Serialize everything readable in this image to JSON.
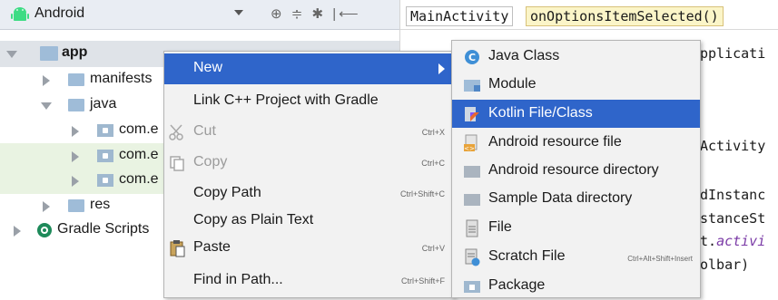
{
  "project_panel": {
    "view_title": "Android",
    "tree": [
      {
        "label": "app",
        "expanded": true,
        "type": "module"
      },
      {
        "label": "manifests",
        "expanded": false,
        "type": "folder"
      },
      {
        "label": "java",
        "expanded": true,
        "type": "folder"
      },
      {
        "label": "com.e",
        "expanded": false,
        "type": "package"
      },
      {
        "label": "com.e",
        "expanded": false,
        "type": "package"
      },
      {
        "label": "com.e",
        "expanded": false,
        "type": "package"
      },
      {
        "label": "res",
        "expanded": false,
        "type": "res-folder"
      },
      {
        "label": "Gradle Scripts",
        "expanded": false,
        "type": "gradle"
      }
    ]
  },
  "editor": {
    "breadcrumb": [
      "MainActivity",
      "onOptionsItemSelected()"
    ],
    "code_fragments": [
      "pplicati",
      "Activity",
      "dInstanc",
      "stanceSt",
      "t.",
      "activi",
      "olbar)"
    ]
  },
  "context_menu": {
    "items": [
      {
        "label": "New",
        "shortcut": "",
        "selected": true,
        "disabled": false,
        "has_submenu": true
      },
      {
        "label": "Link C++ Project with Gradle",
        "shortcut": "",
        "selected": false,
        "disabled": false
      },
      {
        "label": "Cut",
        "shortcut": "Ctrl+X",
        "selected": false,
        "disabled": true,
        "icon": "scissors-icon"
      },
      {
        "label": "Copy",
        "shortcut": "Ctrl+C",
        "selected": false,
        "disabled": true,
        "icon": "copy-icon"
      },
      {
        "label": "Copy Path",
        "shortcut": "Ctrl+Shift+C",
        "selected": false,
        "disabled": false
      },
      {
        "label": "Copy as Plain Text",
        "shortcut": "",
        "selected": false,
        "disabled": false
      },
      {
        "label": "Paste",
        "shortcut": "Ctrl+V",
        "selected": false,
        "disabled": false,
        "icon": "clipboard-icon"
      },
      {
        "label": "Find in Path...",
        "shortcut": "Ctrl+Shift+F",
        "selected": false,
        "disabled": false
      }
    ]
  },
  "submenu": {
    "items": [
      {
        "label": "Java Class",
        "shortcut": "",
        "selected": false,
        "icon": "java-class-icon"
      },
      {
        "label": "Module",
        "shortcut": "",
        "selected": false,
        "icon": "module-icon"
      },
      {
        "label": "Kotlin File/Class",
        "shortcut": "",
        "selected": true,
        "icon": "kotlin-icon"
      },
      {
        "label": "Android resource file",
        "shortcut": "",
        "selected": false,
        "icon": "android-resource-file-icon"
      },
      {
        "label": "Android resource directory",
        "shortcut": "",
        "selected": false,
        "icon": "folder-icon"
      },
      {
        "label": "Sample Data directory",
        "shortcut": "",
        "selected": false,
        "icon": "folder-icon"
      },
      {
        "label": "File",
        "shortcut": "",
        "selected": false,
        "icon": "file-icon"
      },
      {
        "label": "Scratch File",
        "shortcut": "Ctrl+Alt+Shift+Insert",
        "selected": false,
        "icon": "scratch-file-icon"
      },
      {
        "label": "Package",
        "shortcut": "",
        "selected": false,
        "icon": "package-icon"
      }
    ]
  },
  "colors": {
    "selection": "#2f65ca",
    "menu_bg": "#f2f2f2",
    "android_green": "#3ddc84",
    "highlight_rows": "#e9f3e2"
  }
}
